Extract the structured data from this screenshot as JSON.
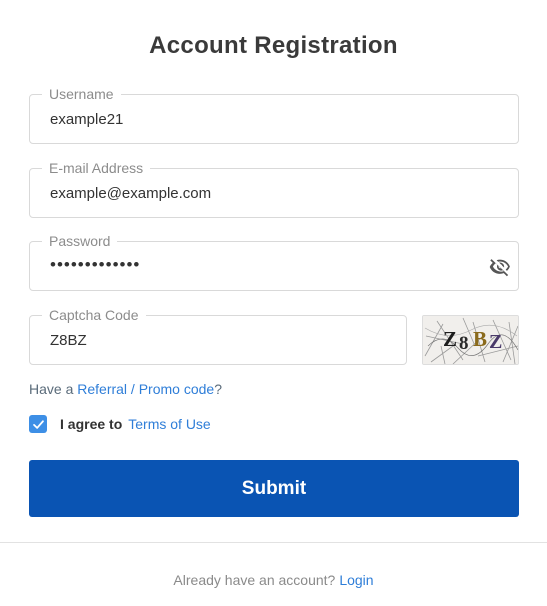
{
  "page": {
    "title": "Account Registration"
  },
  "form": {
    "username": {
      "label": "Username",
      "value": "example21"
    },
    "email": {
      "label": "E-mail Address",
      "value": "example@example.com"
    },
    "password": {
      "label": "Password",
      "value": "•••••••••••••"
    },
    "captcha": {
      "label": "Captcha Code",
      "value": "Z8BZ",
      "image_text": "Z8BZ"
    }
  },
  "referral": {
    "prefix": "Have a ",
    "link": "Referral / Promo code",
    "suffix": "?"
  },
  "agree": {
    "checked": true,
    "text": "I agree to",
    "link": "Terms of Use"
  },
  "submit": {
    "label": "Submit"
  },
  "footer": {
    "text": "Already have an account?",
    "link": "Login"
  },
  "colors": {
    "primary": "#0a54b3",
    "link": "#2f7ed8",
    "checkbox": "#3d8fe6"
  },
  "icons": {
    "password_toggle": "eye-slash-icon",
    "checkbox": "checkmark-icon"
  }
}
